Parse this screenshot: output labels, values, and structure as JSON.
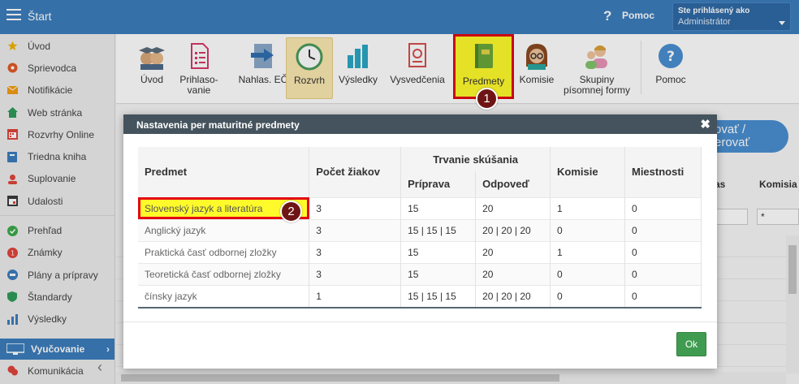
{
  "topbar": {
    "title": "Štart",
    "help_label": "Pomoc",
    "help_symbol": "?",
    "user_line1": "Ste prihlásený ako",
    "user_line2": "Administrátor"
  },
  "sidebar": {
    "items": [
      {
        "label": "Úvod",
        "icon": "star-icon",
        "color": "#f0b400"
      },
      {
        "label": "Sprievodca",
        "icon": "compass-icon",
        "color": "#e05b2a"
      },
      {
        "label": "Notifikácie",
        "icon": "envelope-icon",
        "color": "#f39c12"
      },
      {
        "label": "Web stránka",
        "icon": "home-icon",
        "color": "#2e9b5a"
      },
      {
        "label": "Rozvrhy Online",
        "icon": "calendar-icon",
        "color": "#e0443a"
      },
      {
        "label": "Triedna kniha",
        "icon": "book-icon",
        "color": "#3b7dbd"
      },
      {
        "label": "Suplovanie",
        "icon": "user-swap-icon",
        "color": "#e0443a"
      },
      {
        "label": "Udalosti",
        "icon": "calendar-event-icon",
        "color": "#3a3a3a"
      },
      {
        "label": "Prehľad",
        "icon": "check-circle-icon",
        "color": "#3caa4a"
      },
      {
        "label": "Známky",
        "icon": "grades-icon",
        "color": "#e0443a"
      },
      {
        "label": "Plány a prípravy",
        "icon": "plans-icon",
        "color": "#3b7dbd"
      },
      {
        "label": "Štandardy",
        "icon": "shield-icon",
        "color": "#2e9b5a"
      },
      {
        "label": "Výsledky",
        "icon": "bar-chart-icon",
        "color": "#3b7dbd"
      }
    ],
    "active": {
      "label": "Vyučovanie",
      "icon": "classroom-icon"
    },
    "after_active": {
      "label": "Komunikácia",
      "icon": "chat-icon",
      "color": "#e0443a"
    }
  },
  "toolbar": {
    "buttons": [
      {
        "label": "Úvod",
        "icon": "graduates-icon"
      },
      {
        "label": "Prihlaso-vanie",
        "line1": "Prihlaso-",
        "line2": "vanie",
        "icon": "form-icon"
      },
      {
        "label": "Nahlas. EČ",
        "icon": "report-arrow-icon"
      },
      {
        "label": "Rozvrh",
        "icon": "clock-icon"
      },
      {
        "label": "Výsledky",
        "icon": "bar-chart-icon"
      },
      {
        "label": "Vysvedčenia",
        "icon": "certificate-icon"
      },
      {
        "label": "Predmety",
        "icon": "book-icon"
      },
      {
        "label": "Komisie",
        "icon": "teacher-icon"
      },
      {
        "label": "Skupiny písomnej formy",
        "line1": "Skupiny",
        "line2": "písomnej formy",
        "icon": "group-icon"
      },
      {
        "label": "Pomoc",
        "icon": "help-icon"
      }
    ]
  },
  "background": {
    "action_button_line1": "ovať /",
    "action_button_line2": "erovať",
    "col_as": "as",
    "col_komisia": "Komisia",
    "filter_value": "*"
  },
  "modal": {
    "title": "Nastavenia per maturitné predmety",
    "close": "✖",
    "headers": {
      "predmet": "Predmet",
      "pocet": "Počet žiakov",
      "trvanie": "Trvanie skúšania",
      "priprava": "Príprava",
      "odpoved": "Odpoveď",
      "komisie": "Komisie",
      "miestnosti": "Miestnosti"
    },
    "rows": [
      {
        "predmet": "Slovenský jazyk a literatúra",
        "pocet": "3",
        "priprava": "15",
        "odpoved": "20",
        "komisie": "1",
        "miestnosti": "0"
      },
      {
        "predmet": "Anglický jazyk",
        "pocet": "3",
        "priprava": "15 | 15 | 15",
        "odpoved": "20 | 20 | 20",
        "komisie": "0",
        "miestnosti": "0"
      },
      {
        "predmet": "Praktická časť odbornej zložky",
        "pocet": "3",
        "priprava": "15",
        "odpoved": "20",
        "komisie": "1",
        "miestnosti": "0"
      },
      {
        "predmet": "Teoretická časť odbornej zložky",
        "pocet": "3",
        "priprava": "15",
        "odpoved": "20",
        "komisie": "0",
        "miestnosti": "0"
      },
      {
        "predmet": "čínsky jazyk",
        "pocet": "1",
        "priprava": "15 | 15 | 15",
        "odpoved": "20 | 20 | 20",
        "komisie": "0",
        "miestnosti": "0"
      }
    ],
    "ok_label": "Ok"
  },
  "badges": {
    "one": "1",
    "two": "2"
  },
  "colors": {
    "topbar": "#3b7dbd",
    "modal_header": "#44535d",
    "highlight": "#fffb2b",
    "highlight_border": "#e30613",
    "ok": "#3f9b50"
  }
}
